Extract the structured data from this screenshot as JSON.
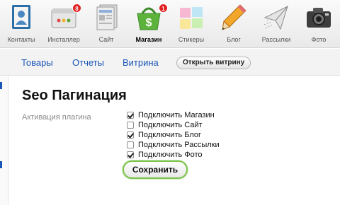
{
  "apps": [
    {
      "label": "Контакты",
      "icon": "contacts-icon"
    },
    {
      "label": "Инсталлер",
      "icon": "installer-icon",
      "badge": "8"
    },
    {
      "label": "Сайт",
      "icon": "site-icon"
    },
    {
      "label": "Магазин",
      "icon": "shop-basket-icon",
      "badge": "1",
      "active": true
    },
    {
      "label": "Стикеры",
      "icon": "stickers-icon"
    },
    {
      "label": "Блог",
      "icon": "blog-pencil-icon"
    },
    {
      "label": "Рассылки",
      "icon": "mailer-icon"
    },
    {
      "label": "Фото",
      "icon": "camera-icon"
    }
  ],
  "subnav": {
    "tovary": "Товары",
    "otchety": "Отчеты",
    "vitrina": "Витрина",
    "open_vitrina": "Открыть витрину"
  },
  "page": {
    "title": "Seo Пагинация",
    "field_label": "Активация плагина",
    "options": [
      {
        "label": "Подключить Магазин",
        "checked": true
      },
      {
        "label": "Подключить Сайт",
        "checked": false
      },
      {
        "label": "Подключить Блог",
        "checked": true
      },
      {
        "label": "Подключить Рассылки",
        "checked": false
      },
      {
        "label": "Подключить Фото",
        "checked": true
      }
    ],
    "save_label": "Сохранить"
  },
  "colors": {
    "accent": "#1a55b8",
    "badge": "#e02020",
    "save_border": "#7bc34a"
  }
}
